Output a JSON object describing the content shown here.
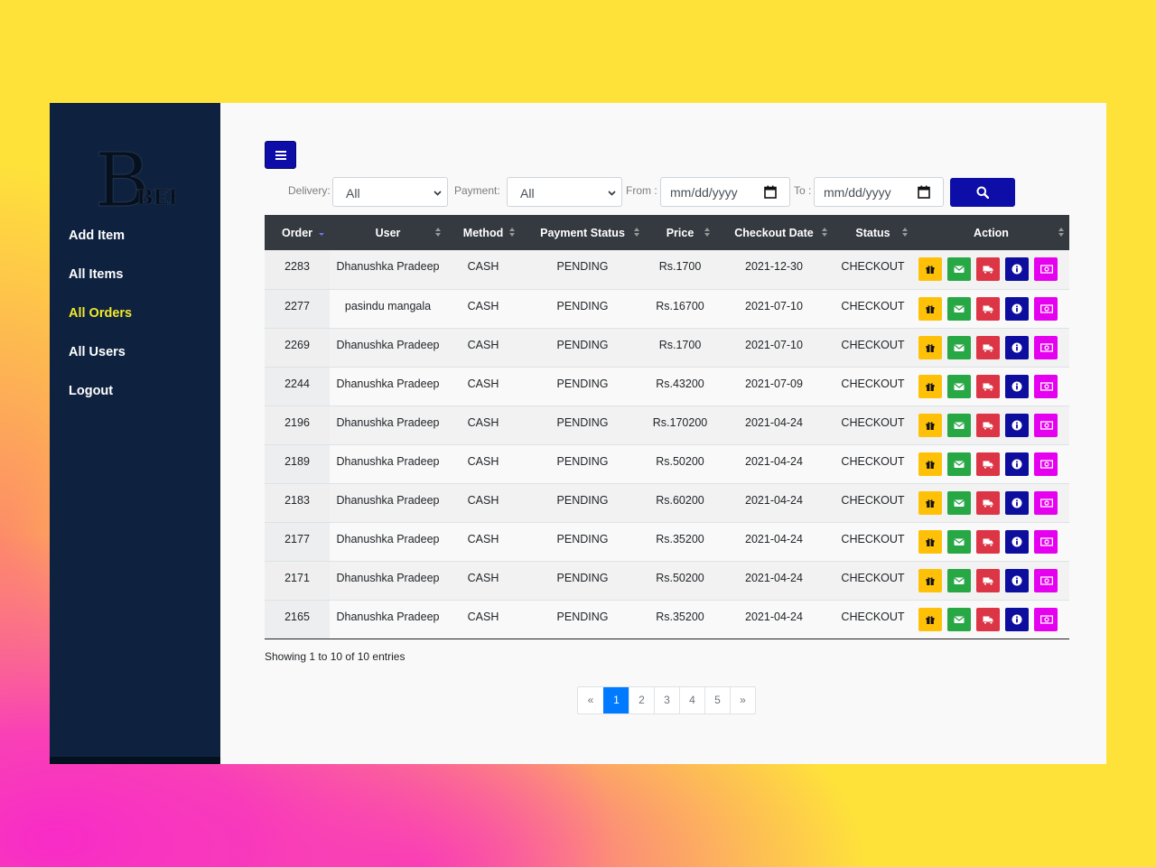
{
  "brand": {
    "logo_text": "BEE",
    "logo_letter": "B"
  },
  "sidebar": {
    "items": [
      {
        "label": "Add Item",
        "active": false
      },
      {
        "label": "All Items",
        "active": false
      },
      {
        "label": "All Orders",
        "active": true
      },
      {
        "label": "All Users",
        "active": false
      },
      {
        "label": "Logout",
        "active": false
      }
    ]
  },
  "filters": {
    "delivery_label": "Delivery:",
    "delivery_value": "All",
    "payment_label": "Payment:",
    "payment_value": "All",
    "from_label": "From :",
    "from_placeholder": "mm/dd/yyyy",
    "to_label": "To :",
    "to_placeholder": "mm/dd/yyyy"
  },
  "table": {
    "columns": [
      "Order",
      "User",
      "Method",
      "Payment Status",
      "Price",
      "Checkout Date",
      "Status",
      "Action"
    ],
    "rows": [
      {
        "order": "2283",
        "user": "Dhanushka Pradeep",
        "method": "CASH",
        "payment_status": "PENDING",
        "price": "Rs.1700",
        "date": "2021-12-30",
        "status": "CHECKOUT"
      },
      {
        "order": "2277",
        "user": "pasindu mangala",
        "method": "CASH",
        "payment_status": "PENDING",
        "price": "Rs.16700",
        "date": "2021-07-10",
        "status": "CHECKOUT"
      },
      {
        "order": "2269",
        "user": "Dhanushka Pradeep",
        "method": "CASH",
        "payment_status": "PENDING",
        "price": "Rs.1700",
        "date": "2021-07-10",
        "status": "CHECKOUT"
      },
      {
        "order": "2244",
        "user": "Dhanushka Pradeep",
        "method": "CASH",
        "payment_status": "PENDING",
        "price": "Rs.43200",
        "date": "2021-07-09",
        "status": "CHECKOUT"
      },
      {
        "order": "2196",
        "user": "Dhanushka Pradeep",
        "method": "CASH",
        "payment_status": "PENDING",
        "price": "Rs.170200",
        "date": "2021-04-24",
        "status": "CHECKOUT"
      },
      {
        "order": "2189",
        "user": "Dhanushka Pradeep",
        "method": "CASH",
        "payment_status": "PENDING",
        "price": "Rs.50200",
        "date": "2021-04-24",
        "status": "CHECKOUT"
      },
      {
        "order": "2183",
        "user": "Dhanushka Pradeep",
        "method": "CASH",
        "payment_status": "PENDING",
        "price": "Rs.60200",
        "date": "2021-04-24",
        "status": "CHECKOUT"
      },
      {
        "order": "2177",
        "user": "Dhanushka Pradeep",
        "method": "CASH",
        "payment_status": "PENDING",
        "price": "Rs.35200",
        "date": "2021-04-24",
        "status": "CHECKOUT"
      },
      {
        "order": "2171",
        "user": "Dhanushka Pradeep",
        "method": "CASH",
        "payment_status": "PENDING",
        "price": "Rs.50200",
        "date": "2021-04-24",
        "status": "CHECKOUT"
      },
      {
        "order": "2165",
        "user": "Dhanushka Pradeep",
        "method": "CASH",
        "payment_status": "PENDING",
        "price": "Rs.35200",
        "date": "2021-04-24",
        "status": "CHECKOUT"
      }
    ],
    "actions": [
      {
        "name": "gift-button",
        "icon": "gift-icon",
        "color": "#ffc107"
      },
      {
        "name": "email-button",
        "icon": "envelope-icon",
        "color": "#28a745"
      },
      {
        "name": "deliver-button",
        "icon": "truck-icon",
        "color": "#dc3545"
      },
      {
        "name": "info-button",
        "icon": "info-icon",
        "color": "#0d0d9e"
      },
      {
        "name": "payment-button",
        "icon": "money-icon",
        "color": "#e600f0"
      }
    ]
  },
  "footer": {
    "info": "Showing 1 to 10 of 10 entries",
    "pagination": [
      "«",
      "1",
      "2",
      "3",
      "4",
      "5",
      "»"
    ],
    "current_page": "1"
  },
  "colors": {
    "sidebar": "#0e2240",
    "active_nav": "#f2ea27",
    "primary_button": "#0d0da8",
    "table_header": "#343a40",
    "page_active": "#007bff"
  }
}
